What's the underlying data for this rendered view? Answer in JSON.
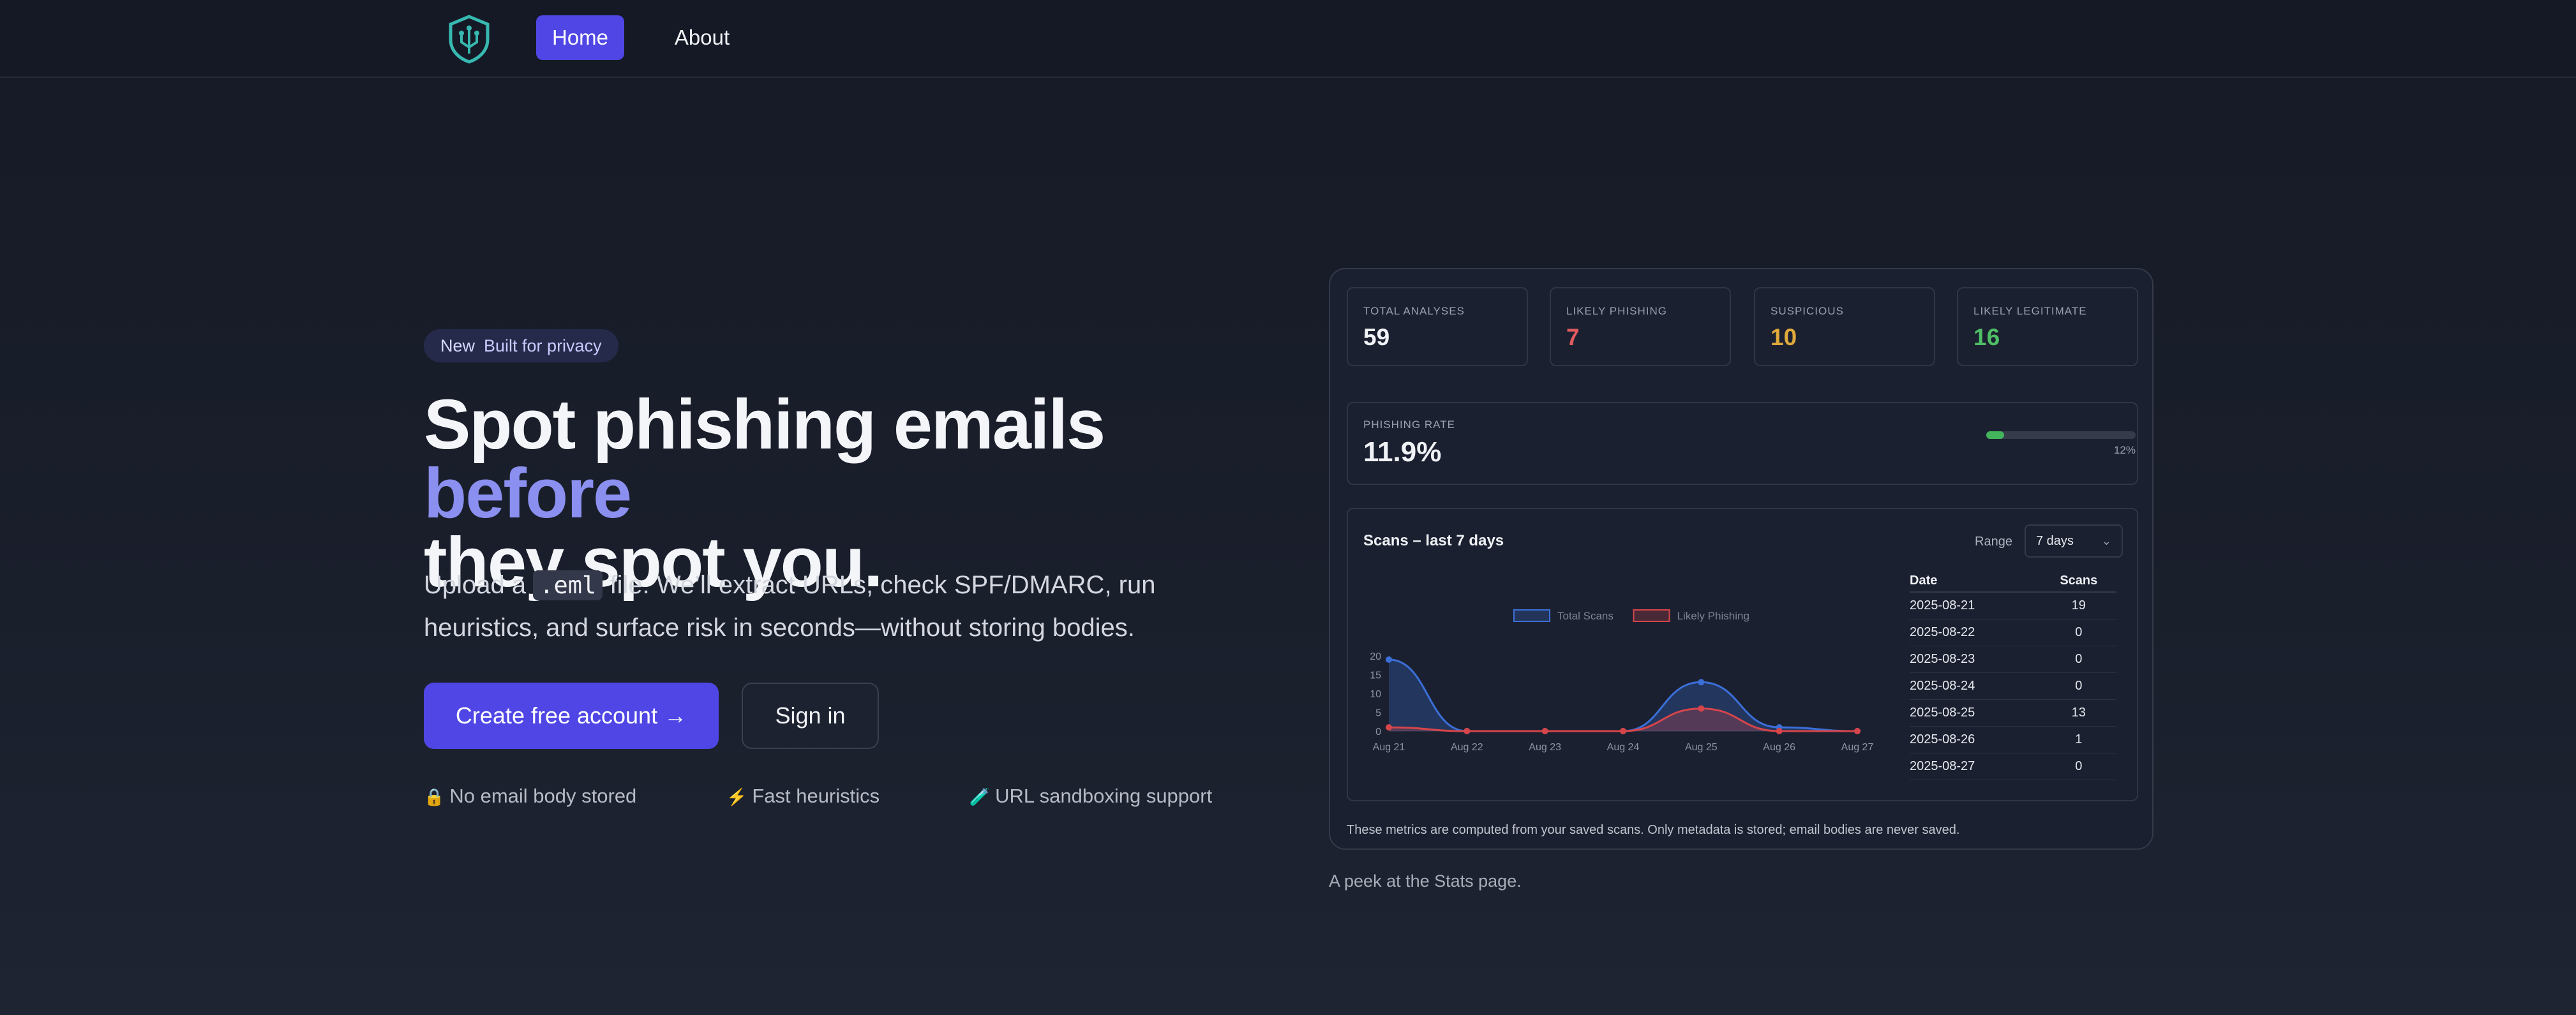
{
  "nav": {
    "logo_icon": "shield-circuit-icon",
    "home_label": "Home",
    "about_label": "About"
  },
  "hero": {
    "badge_new": "New",
    "badge_text": "Built for privacy",
    "headline_part1": "Spot phishing emails ",
    "headline_accent": "before",
    "headline_part2": "they spot you.",
    "sub_before": "Upload a ",
    "sub_code": ".eml",
    "sub_after": " file. We’ll extract URLs, check SPF/DMARC, run heuristics, and surface risk in seconds—without storing bodies.",
    "cta_primary": "Create free account →",
    "cta_secondary": "Sign in",
    "features": [
      {
        "icon": "lock-icon",
        "glyph": "🔒",
        "label": "No email body stored"
      },
      {
        "icon": "lightning-icon",
        "glyph": "⚡",
        "label": "Fast heuristics"
      },
      {
        "icon": "test-tube-icon",
        "glyph": "🧪",
        "label": "URL sandboxing support"
      }
    ]
  },
  "stats": {
    "kpis": [
      {
        "label": "TOTAL ANALYSES",
        "value": "59",
        "color": "#f1f2f6"
      },
      {
        "label": "LIKELY PHISHING",
        "value": "7",
        "color": "#e05a5f"
      },
      {
        "label": "SUSPICIOUS",
        "value": "10",
        "color": "#e0a93b"
      },
      {
        "label": "LIKELY LEGITIMATE",
        "value": "16",
        "color": "#4fbf66"
      }
    ],
    "rate_label": "PHISHING RATE",
    "rate_value": "11.9%",
    "rate_fraction": 0.12,
    "rate_pct_label": "12%",
    "scans_title": "Scans – last 7 days",
    "range_label": "Range",
    "range_value": "7 days",
    "table_headers": [
      "Date",
      "Scans"
    ],
    "table_rows": [
      [
        "2025-08-21",
        "19"
      ],
      [
        "2025-08-22",
        "0"
      ],
      [
        "2025-08-23",
        "0"
      ],
      [
        "2025-08-24",
        "0"
      ],
      [
        "2025-08-25",
        "13"
      ],
      [
        "2025-08-26",
        "1"
      ],
      [
        "2025-08-27",
        "0"
      ]
    ],
    "note": "These metrics are computed from your saved scans. Only metadata is stored; email bodies are never saved."
  },
  "caption": "A peek at the Stats page.",
  "chart_data": {
    "type": "area",
    "categories": [
      "Aug 21",
      "Aug 22",
      "Aug 23",
      "Aug 24",
      "Aug 25",
      "Aug 26",
      "Aug 27"
    ],
    "series": [
      {
        "name": "Total Scans",
        "values": [
          19,
          0,
          0,
          0,
          13,
          1,
          0
        ],
        "color": "#3b6fd8"
      },
      {
        "name": "Likely Phishing",
        "values": [
          1,
          0,
          0,
          0,
          6,
          0,
          0
        ],
        "color": "#d6454a"
      }
    ],
    "yticks": [
      0,
      5,
      10,
      15,
      20
    ],
    "ylim": [
      0,
      20
    ],
    "legend": "top-center",
    "grid": false
  }
}
